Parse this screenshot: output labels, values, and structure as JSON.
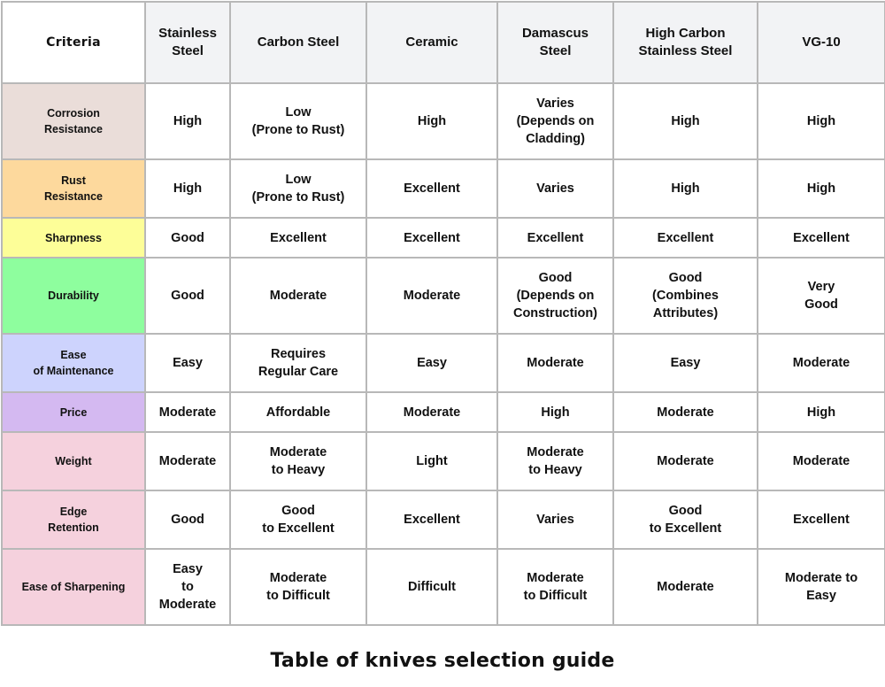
{
  "table": {
    "corner_label": "Criteria",
    "columns": [
      "Stainless\nSteel",
      "Carbon Steel",
      "Ceramic",
      "Damascus\nSteel",
      "High Carbon\nStainless Steel",
      "VG-10"
    ],
    "rows": [
      {
        "criterion": "Corrosion\nResistance",
        "color": "#eaddd9",
        "cells": [
          "High",
          "Low\n(Prone to Rust)",
          "High",
          "Varies\n(Depends on\nCladding)",
          "High",
          "High"
        ]
      },
      {
        "criterion": "Rust\nResistance",
        "color": "#fdd99d",
        "cells": [
          "High",
          "Low\n(Prone to Rust)",
          "Excellent",
          "Varies",
          "High",
          "High"
        ]
      },
      {
        "criterion": "Sharpness",
        "color": "#fdfe98",
        "cells": [
          "Good",
          "Excellent",
          "Excellent",
          "Excellent",
          "Excellent",
          "Excellent"
        ]
      },
      {
        "criterion": "Durability",
        "color": "#8efe9e",
        "cells": [
          "Good",
          "Moderate",
          "Moderate",
          "Good\n(Depends on\nConstruction)",
          "Good\n(Combines\nAttributes)",
          "Very\nGood"
        ]
      },
      {
        "criterion": "Ease\nof Maintenance",
        "color": "#cdd3fd",
        "cells": [
          "Easy",
          "Requires\nRegular Care",
          "Easy",
          "Moderate",
          "Easy",
          "Moderate"
        ]
      },
      {
        "criterion": "Price",
        "color": "#d4b9f1",
        "cells": [
          "Moderate",
          "Affordable",
          "Moderate",
          "High",
          "Moderate",
          "High"
        ]
      },
      {
        "criterion": "Weight",
        "color": "#f5d1dd",
        "cells": [
          "Moderate",
          "Moderate\nto Heavy",
          "Light",
          "Moderate\nto Heavy",
          "Moderate",
          "Moderate"
        ]
      },
      {
        "criterion": "Edge\nRetention",
        "color": "#f5d1dd",
        "cells": [
          "Good",
          "Good\nto Excellent",
          "Excellent",
          "Varies",
          "Good\nto Excellent",
          "Excellent"
        ]
      },
      {
        "criterion": "Ease of Sharpening",
        "color": "#f5d1dd",
        "cells": [
          "Easy\nto\nModerate",
          "Moderate\nto Difficult",
          "Difficult",
          "Moderate\nto Difficult",
          "Moderate",
          "Moderate to\nEasy"
        ]
      }
    ]
  },
  "caption": "Table of knives selection guide"
}
